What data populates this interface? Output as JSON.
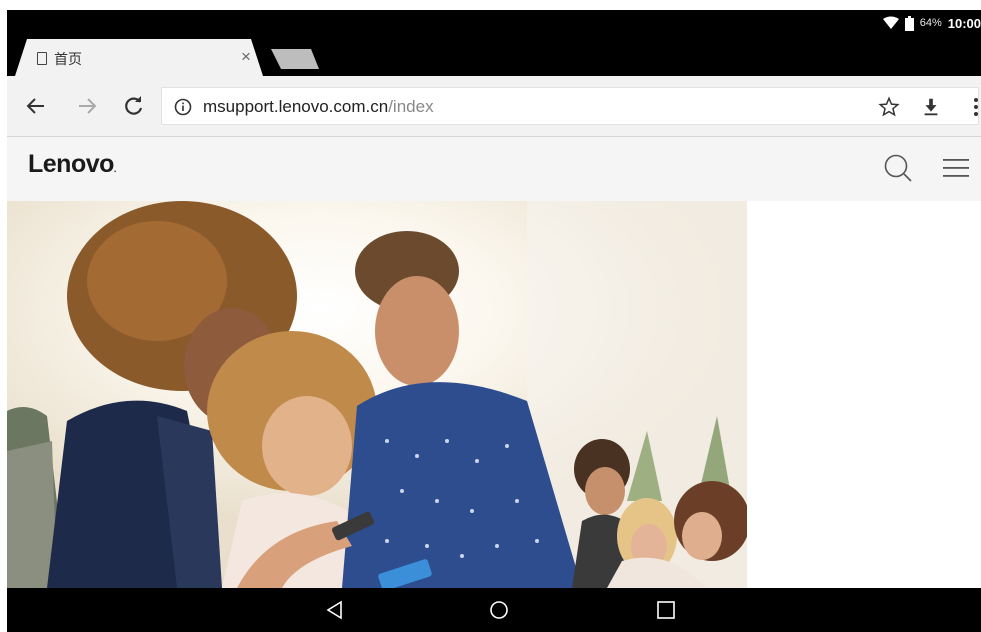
{
  "status_bar": {
    "battery_percent": "64%",
    "time": "10:00",
    "icons": [
      "wifi-icon",
      "battery-icon"
    ]
  },
  "tabs": [
    {
      "title": "首页",
      "active": true,
      "icon": "document-icon"
    }
  ],
  "toolbar": {
    "url_host": "msupport.lenovo.com.cn",
    "url_path": "/index",
    "icons": [
      "back-arrow-icon",
      "forward-arrow-icon",
      "reload-icon",
      "info-icon",
      "star-icon",
      "download-icon",
      "more-vert-icon"
    ]
  },
  "site_header": {
    "logo_text": "Lenovo",
    "logo_suffix": ".",
    "icons": [
      "search-icon",
      "hamburger-menu-icon"
    ]
  },
  "hero": {
    "description_icon": "hero-image"
  },
  "nav_bar": {
    "icons": [
      "back-triangle-icon",
      "home-circle-icon",
      "recents-square-icon"
    ]
  },
  "colors": {
    "chrome_black": "#000000",
    "toolbar_bg": "#f2f2f2",
    "header_bg": "#f5f5f5",
    "url_path": "#888888",
    "shirt_blue": "#2d4d8f"
  }
}
